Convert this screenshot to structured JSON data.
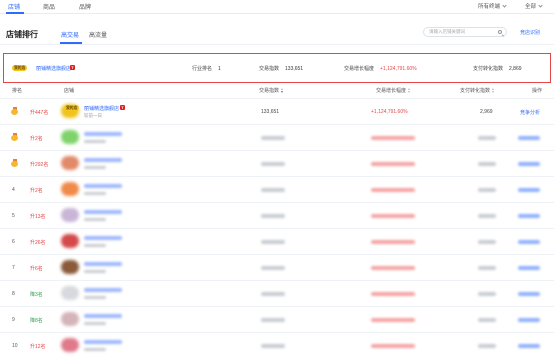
{
  "topnav": {
    "tabs": [
      {
        "label": "店铺",
        "active": true
      },
      {
        "label": "商品",
        "active": false
      },
      {
        "label": "品牌",
        "active": false
      }
    ],
    "terminal_select": "所有终端",
    "scope_select": "全部"
  },
  "section": {
    "title": "店铺排行",
    "subtabs": [
      {
        "label": "高交易",
        "active": true
      },
      {
        "label": "高流量",
        "active": false
      }
    ],
    "search_placeholder": "请输入店铺关键词",
    "compare_link": "竞店识别"
  },
  "own_store": {
    "badge": "我的店",
    "name": "丽铺精选旗舰店",
    "tmall_icon": "T",
    "industry_rank_label": "行业排名",
    "industry_rank_value": "1",
    "trade_index_label": "交易指数",
    "trade_index_value": "133,651",
    "growth_label": "交易增长幅度",
    "growth_value": "+1,124,791.60%",
    "conversion_label": "支付转化指数",
    "conversion_value": "2,869"
  },
  "table": {
    "headers": {
      "rank": "排名",
      "store": "店铺",
      "trade_index": "交易指数",
      "growth": "交易增长幅度",
      "conversion": "支付转化指数",
      "action": "操作"
    },
    "rows": [
      {
        "rank": "1",
        "medal": true,
        "change": "升447名",
        "dir": "up",
        "name": "丽铺精选旗舰店",
        "sub": "较前一日",
        "trade": "133,651",
        "growth": "+1,124,791.60%",
        "conversion": "2,969",
        "action": "竞争分析",
        "thumb": "#f0c21a"
      },
      {
        "rank": "2",
        "medal": true,
        "change": "升2名",
        "dir": "up",
        "thumb": "#7fd36a"
      },
      {
        "rank": "3",
        "medal": true,
        "change": "升292名",
        "dir": "up",
        "thumb": "#e08a6a"
      },
      {
        "rank": "4",
        "medal": false,
        "change": "升2名",
        "dir": "up",
        "thumb": "#f08a4a"
      },
      {
        "rank": "5",
        "medal": false,
        "change": "升13名",
        "dir": "up",
        "thumb": "#c9b6d6"
      },
      {
        "rank": "6",
        "medal": false,
        "change": "升26名",
        "dir": "up",
        "thumb": "#d44a4a"
      },
      {
        "rank": "7",
        "medal": false,
        "change": "升6名",
        "dir": "up",
        "thumb": "#8a5a3a"
      },
      {
        "rank": "8",
        "medal": false,
        "change": "降3名",
        "dir": "down",
        "thumb": "#d7d9de"
      },
      {
        "rank": "9",
        "medal": false,
        "change": "降8名",
        "dir": "down",
        "thumb": "#d4b4b8"
      },
      {
        "rank": "10",
        "medal": false,
        "change": "升12名",
        "dir": "up",
        "thumb": "#e07a8a"
      }
    ]
  }
}
